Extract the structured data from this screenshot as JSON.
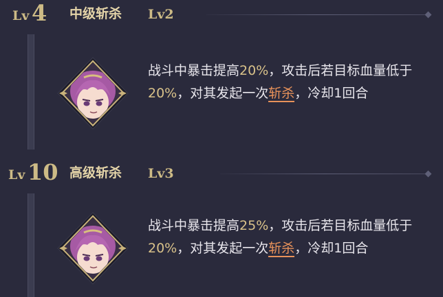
{
  "tiers": [
    {
      "lv_prefix": "Lv",
      "level": "4",
      "skill_name": "中级斩杀",
      "skill_level": "Lv2",
      "desc": {
        "p1": "战斗中暴击提高",
        "v1": "20%",
        "p2": "，攻击后若目标血量低于",
        "v2": "20%",
        "p3": "，对其发起一次",
        "keyword": "斩杀",
        "p4": "，冷却1回合"
      }
    },
    {
      "lv_prefix": "Lv",
      "level": "10",
      "skill_name": "高级斩杀",
      "skill_level": "Lv3",
      "desc": {
        "p1": "战斗中暴击提高",
        "v1": "25%",
        "p2": "，攻击后若目标血量低于",
        "v2": "20%",
        "p3": "，对其发起一次",
        "keyword": "斩杀",
        "p4": "，冷却1回合"
      }
    }
  ],
  "colors": {
    "background": "#2a2a3c",
    "level_gold": "#cdbb86",
    "value_highlight": "#d9c28a",
    "keyword_orange": "#e8925a"
  },
  "icons": [
    "character-portrait-icon"
  ]
}
